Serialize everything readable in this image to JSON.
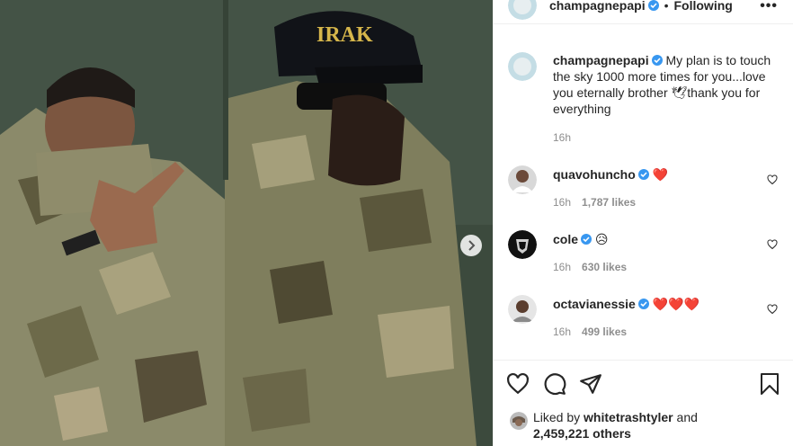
{
  "post": {
    "author": "champagnepapi",
    "follow_state": "Following",
    "separator": "•",
    "more_label": "•••"
  },
  "photo": {
    "cap_text": "IRAK"
  },
  "caption": {
    "username": "champagnepapi",
    "text": "My plan is to touch the sky 1000 more times for you...love you eternally brother 🕊thank you for everything",
    "time": "16h"
  },
  "comments": [
    {
      "username": "quavohuncho",
      "text": "❤️",
      "time": "16h",
      "likes": "1,787 likes"
    },
    {
      "username": "cole",
      "text": "😥",
      "time": "16h",
      "likes": "630 likes"
    },
    {
      "username": "octavianessie",
      "text": "❤️❤️❤️",
      "time": "16h",
      "likes": "499 likes"
    }
  ],
  "likes": {
    "prefix": "Liked by ",
    "liker": "whitetrashtyler",
    "middle": " and",
    "count": "2,459,221 others"
  },
  "colors": {
    "verified": "#3897f0",
    "heart": "#ed4956",
    "muted": "#8e8e8e",
    "camo_base": "#8a8a68"
  }
}
